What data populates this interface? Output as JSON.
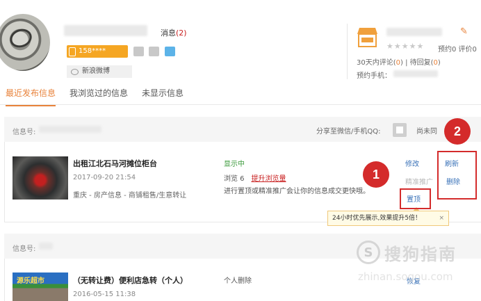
{
  "profile": {
    "messages_label": "消息",
    "messages_count": "(2)",
    "phone_masked": "158****",
    "weibo_label": "新浪微博"
  },
  "shop": {
    "stars": "★★★★★",
    "yuyue": "预约0 评价0",
    "reviews_prefix": "30天内评论(",
    "reviews_count": "0",
    "reviews_mid": ") | 待回复(",
    "reply_count": "0",
    "reviews_suffix": ")",
    "phone_label": "预约手机："
  },
  "tabs": [
    "最近发布信息",
    "我浏览过的信息",
    "未显示信息"
  ],
  "item1": {
    "info_label": "信息号:",
    "share_label": "分享至微信/手机QQ:",
    "shang_label": "尚未同",
    "title": "出租江北石马河摊位柜台",
    "date": "2017-09-20 21:54",
    "category": "重庆 - 房产信息 - 商铺租售/生意转让",
    "status": "显示中",
    "views": "浏览 6",
    "boost": "提升浏览量",
    "tip": "进行置顶或精准推广会让你的信息成交更快哦。",
    "actions": {
      "edit": "修改",
      "precise": "精准推广",
      "top": "置顶",
      "refresh": "刷新",
      "delete": "删除"
    },
    "tooltip": "24小时优先展示,效果提升5倍！",
    "tooltip_close": "×"
  },
  "annotations": {
    "one": "1",
    "two": "2"
  },
  "item2": {
    "info_label": "信息号:",
    "thumb_text": "源乐超市",
    "title": "（无转让费）便利店急转（个人）",
    "date": "2016-05-15 11:38",
    "status": "个人删除",
    "restore": "恢复"
  },
  "watermark": {
    "logo": "S",
    "text": "搜狗指南",
    "url": "zhinan.sogou.com"
  },
  "colors": {
    "accent": "#e8823a",
    "link": "#3a72b8",
    "annotation": "#d42b2b",
    "status_green": "#3a9a3a"
  }
}
